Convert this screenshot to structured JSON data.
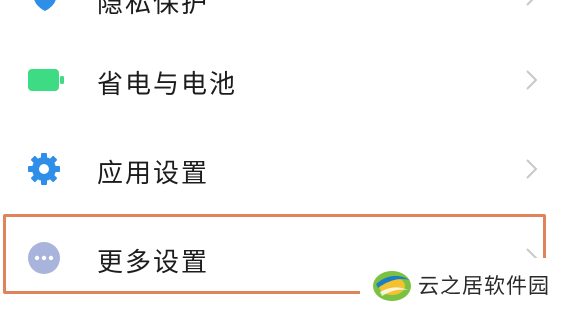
{
  "settings": {
    "items": [
      {
        "label": "隐私保护",
        "icon": "shield-icon"
      },
      {
        "label": "省电与电池",
        "icon": "battery-icon"
      },
      {
        "label": "应用设置",
        "icon": "gear-icon"
      },
      {
        "label": "更多设置",
        "icon": "more-dots-icon"
      }
    ]
  },
  "watermark": {
    "text": "云之居软件园",
    "icon": "logo-icon"
  },
  "colors": {
    "battery": "#3ddc84",
    "gear": "#2f8fe8",
    "more": "#a9b4dc",
    "highlight_border": "#e0825a",
    "chevron": "#c8c8c8"
  }
}
